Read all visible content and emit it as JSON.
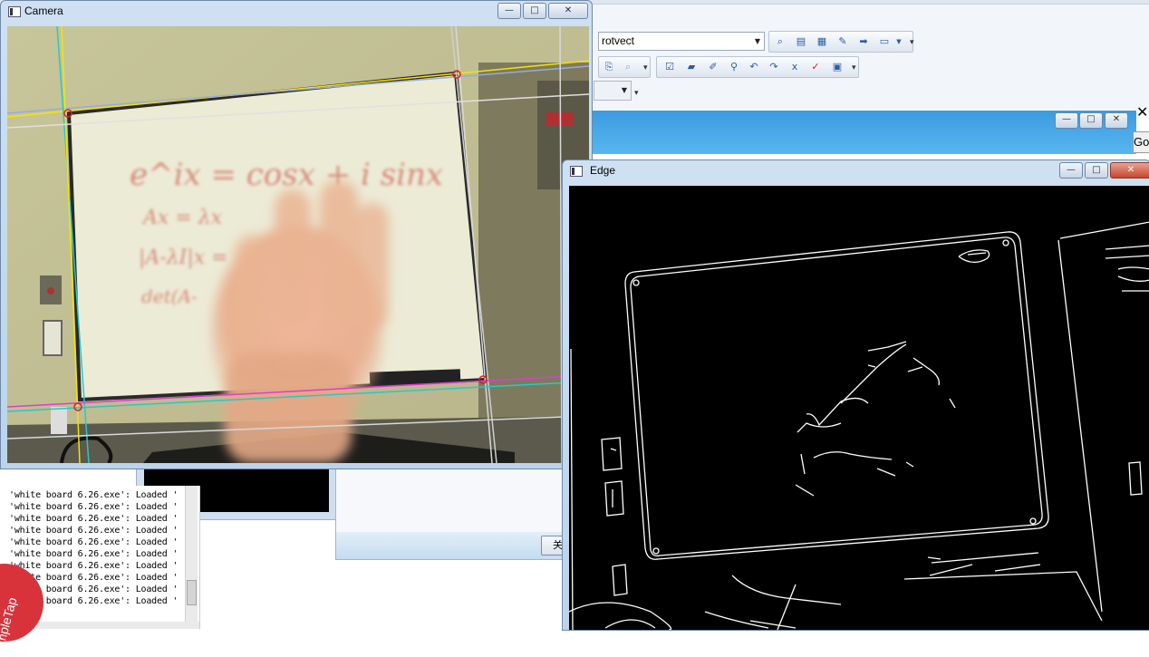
{
  "ide": {
    "config_combo": "rotvect",
    "go_label": "Go",
    "stray_close": "✕",
    "dialog_button_label": "关闭"
  },
  "output": {
    "lines": [
      "'white board 6.26.exe': Loaded '",
      "'white board 6.26.exe': Loaded '",
      "'white board 6.26.exe': Loaded '",
      "'white board 6.26.exe': Loaded '",
      "'white board 6.26.exe': Loaded '",
      "'white board 6.26.exe': Loaded '",
      "'white board 6.26.exe': Loaded '",
      "'white board 6.26.exe': Loaded '",
      "'white board 6.26.exe': Loaded '",
      "'white board 6.26.exe': Loaded '"
    ]
  },
  "camera_window": {
    "title": "Camera",
    "minimize": "—",
    "maximize": "□",
    "close": "✕",
    "whiteboard_writing": [
      "e^ix = cosx + i sinx",
      "Ax = λx",
      "|A-λI|x =",
      "det(A-"
    ]
  },
  "edge_window": {
    "title": "Edge",
    "minimize": "—",
    "maximize": "□",
    "close": "✕"
  },
  "simpletap_label": "SimpleTap",
  "colors": {
    "window_frame": "#bcd3ea",
    "close_button": "#c7452f",
    "board_white": "#ecebd6",
    "wall_tan": "#c9c49a",
    "overlay_yellow": "#f5e400",
    "overlay_cyan": "#28c8c8",
    "overlay_magenta": "#e03cd0",
    "edge_lines": "#ffffff"
  }
}
